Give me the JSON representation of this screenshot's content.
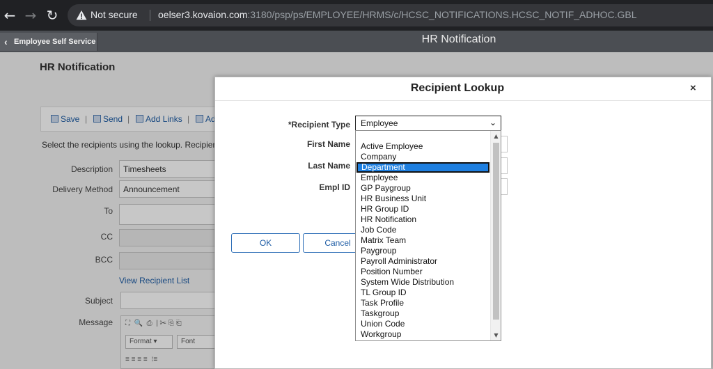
{
  "browser": {
    "security_label": "Not secure",
    "url_host": "oelser3.kovaion.com",
    "url_path": ":3180/psp/ps/EMPLOYEE/HRMS/c/HCSC_NOTIFICATIONS.HCSC_NOTIF_ADHOC.GBL",
    "back_icon": "arrow-left-icon",
    "forward_icon": "arrow-right-icon",
    "reload_icon": "reload-icon"
  },
  "appbar": {
    "back_label": "Employee Self Service",
    "title": "HR Notification"
  },
  "page": {
    "title": "HR Notification",
    "toolbar": {
      "save": "Save",
      "send": "Send",
      "add_links": "Add Links",
      "fourth_partial": "Ad"
    },
    "help_text": "Select the recipients using the lookup. Recipients",
    "fields": {
      "description_label": "Description",
      "description_value": "Timesheets",
      "delivery_label": "Delivery Method",
      "delivery_value": "Announcement",
      "to_label": "To",
      "cc_label": "CC",
      "bcc_label": "BCC",
      "view_recipient_list": "View Recipient List",
      "subject_label": "Subject",
      "message_label": "Message"
    },
    "editor": {
      "format_label": "Format",
      "font_label": "Font"
    }
  },
  "modal": {
    "title": "Recipient Lookup",
    "close_label": "×",
    "recipient_type_label": "*Recipient Type",
    "recipient_type_value": "Employee",
    "first_name_label": "First Name",
    "last_name_label": "Last Name",
    "empl_id_label": "Empl ID",
    "ok_label": "OK",
    "cancel_label": "Cancel"
  },
  "dropdown": {
    "highlighted": "Department",
    "options": [
      "",
      "Active Employee",
      "Company",
      "Department",
      "Employee",
      "GP Paygroup",
      "HR Business Unit",
      "HR Group ID",
      "HR Notification",
      "Job Code",
      "Matrix Team",
      "Paygroup",
      "Payroll Administrator",
      "Position Number",
      "System Wide Distribution",
      "TL Group ID",
      "Task Profile",
      "Taskgroup",
      "Union Code",
      "Workgroup"
    ]
  },
  "colors": {
    "chrome_bg": "#202124",
    "appbar_bg": "#4b4e53",
    "link_blue": "#1c5ba4",
    "selection_blue": "#1e7fe0"
  }
}
